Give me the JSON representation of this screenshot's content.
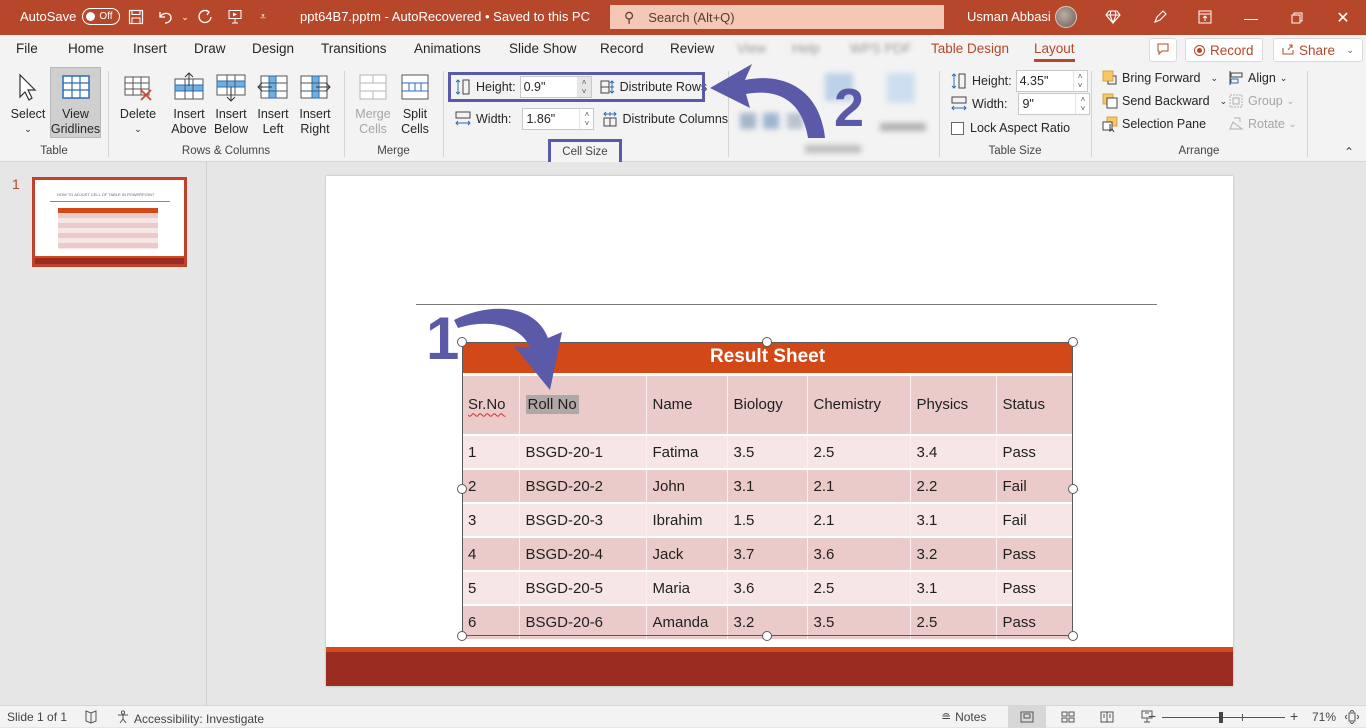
{
  "titlebar": {
    "autosave_label": "AutoSave",
    "autosave_state": "Off",
    "document_title": "ppt64B7.pptm  -  AutoRecovered • Saved to this PC",
    "search_placeholder": "Search (Alt+Q)",
    "user_name": "Usman Abbasi",
    "quick_access": [
      "save-icon",
      "undo-icon",
      "redo-icon",
      "present-icon",
      "customize-icon"
    ],
    "right_icons": [
      "premium-diamond-icon",
      "pen-icon",
      "ribbon-display-icon"
    ],
    "window_controls": [
      "minimize",
      "restore",
      "close"
    ]
  },
  "tabs": {
    "items": [
      {
        "label": "File"
      },
      {
        "label": "Home"
      },
      {
        "label": "Insert"
      },
      {
        "label": "Draw"
      },
      {
        "label": "Design"
      },
      {
        "label": "Transitions"
      },
      {
        "label": "Animations"
      },
      {
        "label": "Slide Show"
      },
      {
        "label": "Record"
      },
      {
        "label": "Review"
      },
      {
        "label": "View"
      },
      {
        "label": "Help"
      },
      {
        "label": "WPS PDF"
      },
      {
        "label": "Table Design"
      },
      {
        "label": "Layout"
      }
    ],
    "active": "Layout",
    "comments_icon": "comment-icon",
    "record_button": "Record",
    "share_button": "Share"
  },
  "ribbon": {
    "table": {
      "label": "Table",
      "select": "Select",
      "view_gridlines_1": "View",
      "view_gridlines_2": "Gridlines"
    },
    "rows_columns": {
      "label": "Rows & Columns",
      "delete": "Delete",
      "insert_above_1": "Insert",
      "insert_above_2": "Above",
      "insert_below_1": "Insert",
      "insert_below_2": "Below",
      "insert_left_1": "Insert",
      "insert_left_2": "Left",
      "insert_right_1": "Insert",
      "insert_right_2": "Right"
    },
    "merge": {
      "label": "Merge",
      "merge_cells_1": "Merge",
      "merge_cells_2": "Cells",
      "split_cells_1": "Split",
      "split_cells_2": "Cells"
    },
    "cell_size": {
      "label": "Cell Size",
      "height_label": "Height:",
      "height_value": "0.9\"",
      "width_label": "Width:",
      "width_value": "1.86\"",
      "distribute_rows": "Distribute Rows",
      "distribute_columns": "Distribute Columns"
    },
    "alignment": {
      "label": "Alignment"
    },
    "table_size": {
      "label": "Table Size",
      "height_label": "Height:",
      "height_value": "4.35\"",
      "width_label": "Width:",
      "width_value": "9\"",
      "lock_aspect_ratio": "Lock Aspect Ratio",
      "lock_checked": false
    },
    "arrange": {
      "label": "Arrange",
      "bring_forward": "Bring Forward",
      "send_backward": "Send Backward",
      "selection_pane": "Selection Pane",
      "align": "Align",
      "group": "Group",
      "rotate": "Rotate"
    }
  },
  "thumbnails": [
    {
      "number": "1",
      "title": "HOW TO ADJUST CELL OF TABLE IN POWERPOINT"
    }
  ],
  "slide": {
    "table_title": "Result  Sheet",
    "headers": [
      "Sr.No",
      "Roll No",
      "Name",
      "Biology",
      "Chemistry",
      "Physics",
      "Status"
    ],
    "rows": [
      [
        "1",
        "BSGD-20-1",
        "Fatima",
        "3.5",
        "2.5",
        "3.4",
        "Pass"
      ],
      [
        "2",
        "BSGD-20-2",
        "John",
        "3.1",
        "2.1",
        "2.2",
        "Fail"
      ],
      [
        "3",
        "BSGD-20-3",
        "Ibrahim",
        "1.5",
        "2.1",
        "3.1",
        "Fail"
      ],
      [
        "4",
        "BSGD-20-4",
        "Jack",
        "3.7",
        "3.6",
        "3.2",
        "Pass"
      ],
      [
        "5",
        "BSGD-20-5",
        "Maria",
        "3.6",
        "2.5",
        "3.1",
        "Pass"
      ],
      [
        "6",
        "BSGD-20-6",
        "Amanda",
        "3.2",
        "3.5",
        "2.5",
        "Pass"
      ]
    ],
    "annotations": {
      "step1": "1",
      "step2": "2"
    },
    "colors": {
      "title_bg": "#d34817",
      "band_dark": "#ebcbca",
      "band_light": "#f6e6e6",
      "footer": "#9a2c22",
      "annotation": "#5b5aa8"
    }
  },
  "statusbar": {
    "slide_info": "Slide 1 of 1",
    "accessibility": "Accessibility: Investigate",
    "notes": "Notes",
    "zoom_percent": "71%",
    "zoom_level": 0.71
  }
}
